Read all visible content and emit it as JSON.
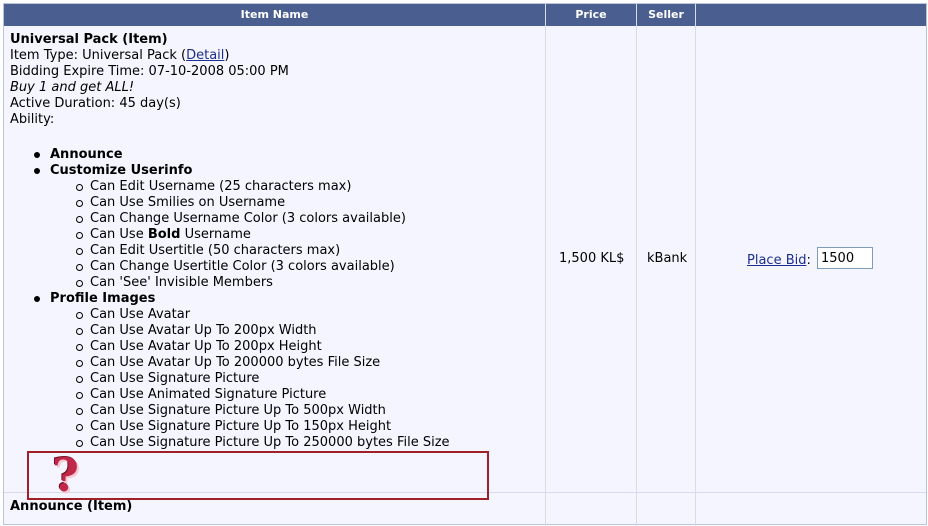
{
  "table": {
    "headers": {
      "item_name": "Item Name",
      "price": "Price",
      "seller": "Seller",
      "action": ""
    },
    "row1": {
      "name": "Universal Pack (Item)",
      "item_type_prefix": "Item Type: Universal Pack (",
      "detail_link": "Detail",
      "item_type_suffix": ")",
      "expire": "Bidding Expire Time: 07-10-2008 05:00 PM",
      "slogan": "Buy 1 and get ALL!",
      "duration": "Active Duration: 45 day(s)",
      "ability": "Ability:",
      "abilities": [
        {
          "label": "Announce",
          "subs": []
        },
        {
          "label": "Customize Userinfo",
          "subs": [
            "Can Edit Username (25 characters max)",
            "Can Use Smilies on Username",
            "Can Change Username Color (3 colors available)",
            "__BOLD__",
            "Can Edit Usertitle (50 characters max)",
            "Can Change Usertitle Color (3 colors available)",
            "Can 'See' Invisible Members"
          ]
        },
        {
          "label": "Profile Images",
          "subs": [
            "Can Use Avatar",
            "Can Use Avatar Up To 200px Width",
            "Can Use Avatar Up To 200px Height",
            "Can Use Avatar Up To 200000 bytes File Size",
            "Can Use Signature Picture",
            "Can Use Animated Signature Picture",
            "Can Use Signature Picture Up To 500px Width",
            "Can Use Signature Picture Up To 150px Height",
            "Can Use Signature Picture Up To 250000 bytes File Size"
          ]
        }
      ],
      "bold_item": {
        "prefix": "Can Use ",
        "bold": "Bold",
        "suffix": " Username"
      },
      "price": "1,500 KL$",
      "seller": "kBank",
      "place_bid_label": "Place Bid",
      "place_bid_colon": ":",
      "bid_value": "1500"
    },
    "row2": {
      "name": "Announce (Item)"
    }
  },
  "overlay": {
    "icon": "question-mark-icon",
    "glyph": "?",
    "highlight_color": "#a02028"
  },
  "colors": {
    "header_bg": "#4a5f8f",
    "row_bg": "#f5f5ff",
    "link": "#1c2f8c"
  }
}
